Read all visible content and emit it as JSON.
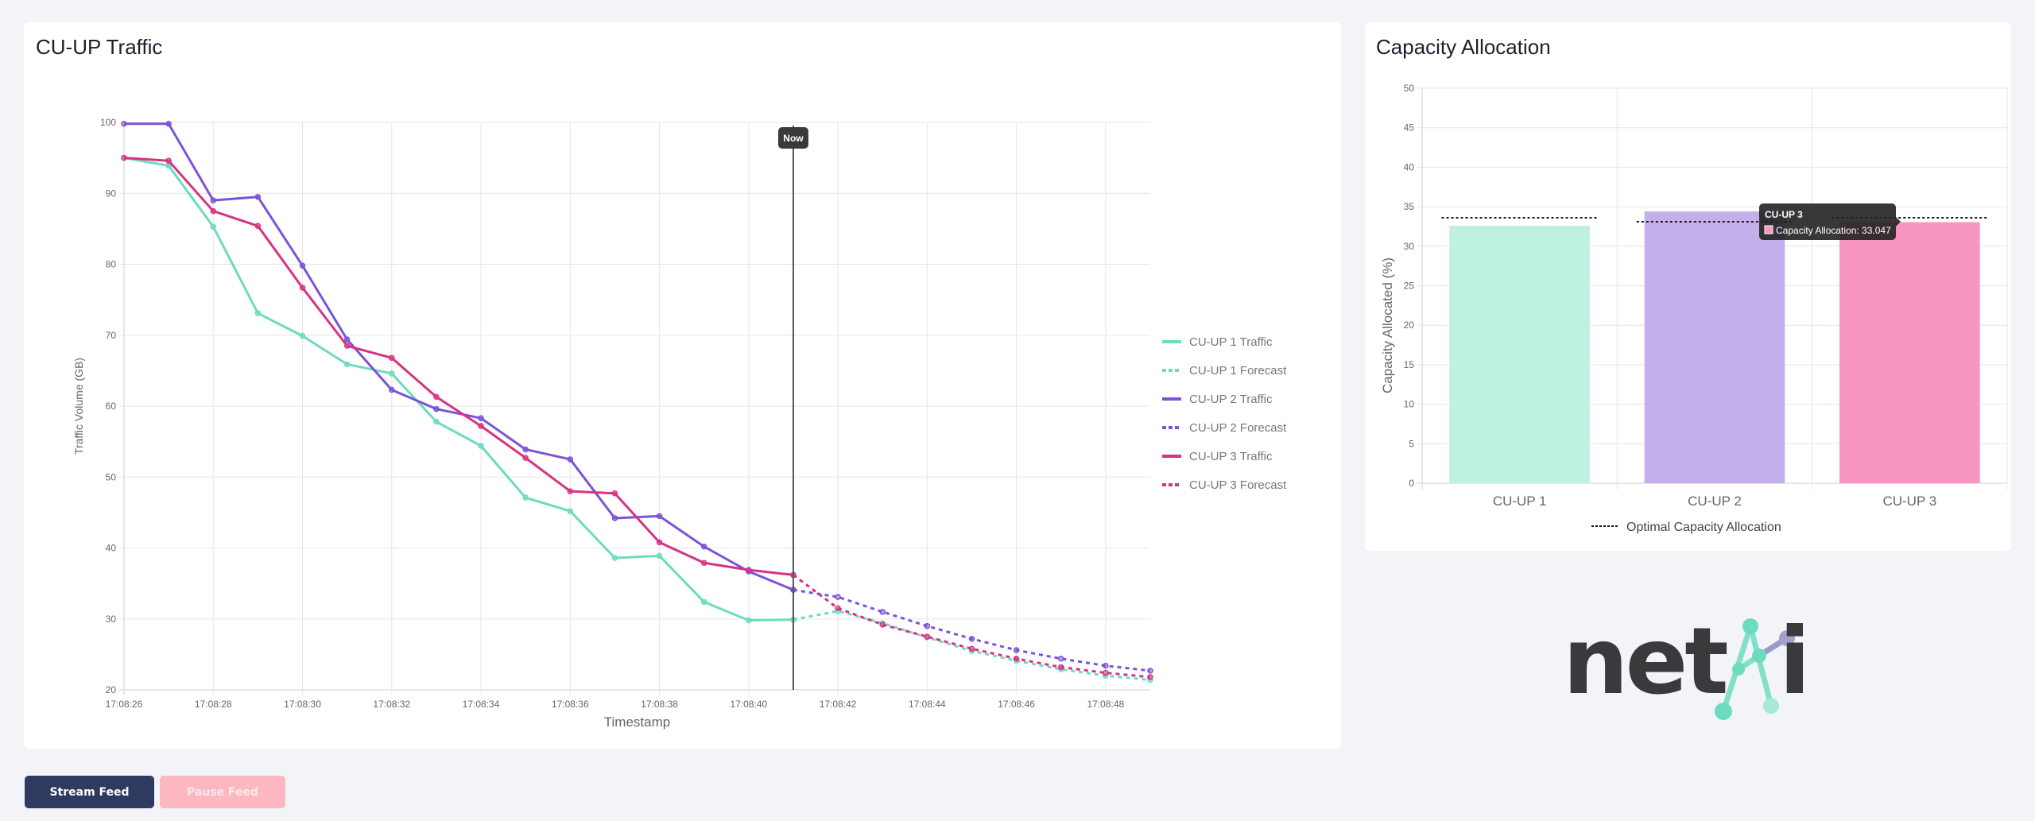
{
  "traffic_panel": {
    "title": "CU-UP Traffic",
    "now_label": "Now"
  },
  "capacity_panel": {
    "title": "Capacity Allocation",
    "tooltip": {
      "title": "CU-UP 3",
      "label": "Capacity Allocation: 33.047"
    }
  },
  "logo": {
    "text": "net",
    "suffix": "i",
    "brand": "netAi"
  },
  "buttons": {
    "stream_label": "Stream Feed",
    "pause_label": "Pause Feed"
  },
  "colors": {
    "cuup1": "#6ddbc0",
    "cuup2": "#7c53d6",
    "cuup3": "#d63384",
    "bar1": "#bff1e2",
    "bar2": "#c3afe9",
    "bar3": "#f895c0",
    "now_line": "#555555",
    "grid": "#e6e6e6",
    "axis_text": "#666666"
  },
  "chart_data": [
    {
      "type": "line",
      "title": "CU-UP Traffic",
      "xlabel": "Timestamp",
      "ylabel": "Traffic Volume (GB)",
      "ylim": [
        20,
        100
      ],
      "yticks": [
        20,
        30,
        40,
        50,
        60,
        70,
        80,
        90,
        100
      ],
      "x": [
        "17:08:26",
        "17:08:27",
        "17:08:28",
        "17:08:29",
        "17:08:30",
        "17:08:31",
        "17:08:32",
        "17:08:33",
        "17:08:34",
        "17:08:35",
        "17:08:36",
        "17:08:37",
        "17:08:38",
        "17:08:39",
        "17:08:40",
        "17:08:41",
        "17:08:42",
        "17:08:43",
        "17:08:44",
        "17:08:45",
        "17:08:46",
        "17:08:47",
        "17:08:48",
        "17:08:49"
      ],
      "xtick_labels": [
        "17:08:26",
        "17:08:28",
        "17:08:30",
        "17:08:32",
        "17:08:34",
        "17:08:36",
        "17:08:38",
        "17:08:40",
        "17:08:42",
        "17:08:44",
        "17:08:46",
        "17:08:48"
      ],
      "now_marker": "17:08:41",
      "grid": true,
      "legend_position": "right",
      "series": [
        {
          "name": "CU-UP 1 Traffic",
          "color_key": "cuup1",
          "dashed": false,
          "values": [
            95.0,
            93.9,
            85.3,
            73.1,
            69.9,
            65.9,
            64.6,
            57.8,
            54.4,
            47.1,
            45.2,
            38.6,
            38.9,
            32.4,
            29.8,
            29.9,
            null,
            null,
            null,
            null,
            null,
            null,
            null,
            null
          ]
        },
        {
          "name": "CU-UP 1 Forecast",
          "color_key": "cuup1",
          "dashed": true,
          "values": [
            null,
            null,
            null,
            null,
            null,
            null,
            null,
            null,
            null,
            null,
            null,
            null,
            null,
            null,
            null,
            29.9,
            31.1,
            29.4,
            27.4,
            25.5,
            24.1,
            22.9,
            22.0,
            21.4
          ]
        },
        {
          "name": "CU-UP 2 Traffic",
          "color_key": "cuup2",
          "dashed": false,
          "values": [
            99.8,
            99.8,
            89.0,
            89.5,
            79.8,
            69.4,
            62.3,
            59.6,
            58.3,
            53.9,
            52.5,
            44.2,
            44.5,
            40.2,
            36.7,
            34.1,
            null,
            null,
            null,
            null,
            null,
            null,
            null,
            null
          ]
        },
        {
          "name": "CU-UP 2 Forecast",
          "color_key": "cuup2",
          "dashed": true,
          "values": [
            null,
            null,
            null,
            null,
            null,
            null,
            null,
            null,
            null,
            null,
            null,
            null,
            null,
            null,
            null,
            34.1,
            33.1,
            31.0,
            29.0,
            27.2,
            25.6,
            24.4,
            23.4,
            22.7
          ]
        },
        {
          "name": "CU-UP 3 Traffic",
          "color_key": "cuup3",
          "dashed": false,
          "values": [
            95.0,
            94.6,
            87.5,
            85.4,
            76.7,
            68.5,
            66.8,
            61.3,
            57.2,
            52.7,
            48.0,
            47.7,
            40.8,
            37.9,
            36.9,
            36.2,
            null,
            null,
            null,
            null,
            null,
            null,
            null,
            null
          ]
        },
        {
          "name": "CU-UP 3 Forecast",
          "color_key": "cuup3",
          "dashed": true,
          "values": [
            null,
            null,
            null,
            null,
            null,
            null,
            null,
            null,
            null,
            null,
            null,
            null,
            null,
            null,
            null,
            36.2,
            31.5,
            29.2,
            27.5,
            25.8,
            24.4,
            23.2,
            22.4,
            21.8
          ]
        }
      ]
    },
    {
      "type": "bar",
      "title": "Capacity Allocation",
      "xlabel": "",
      "ylabel": "Capacity Allocated (%)",
      "ylim": [
        0,
        50
      ],
      "yticks": [
        0,
        5,
        10,
        15,
        20,
        25,
        30,
        35,
        40,
        45,
        50
      ],
      "categories": [
        "CU-UP 1",
        "CU-UP 2",
        "CU-UP 3"
      ],
      "grid": true,
      "legend_position": "bottom",
      "series": [
        {
          "name": "Capacity Allocation",
          "values": [
            32.6,
            34.4,
            33.047
          ],
          "color_keys": [
            "bar1",
            "bar2",
            "bar3"
          ]
        },
        {
          "name": "Optimal Capacity Allocation",
          "values": [
            33.6,
            33.1,
            33.6
          ],
          "dashed": true,
          "color": "#1a1a1a"
        }
      ]
    }
  ]
}
